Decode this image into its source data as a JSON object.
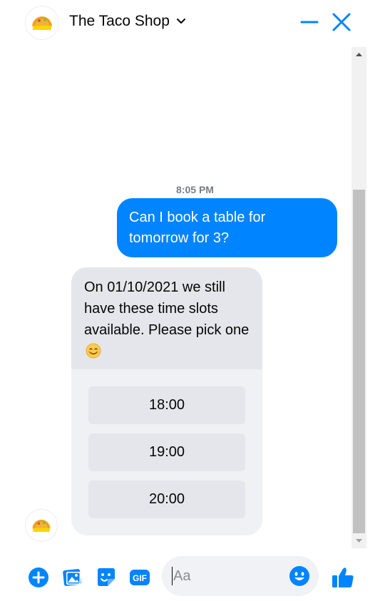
{
  "header": {
    "title": "The Taco Shop",
    "logo_text": "THE TACO SHOP"
  },
  "conversation": {
    "timestamp": "8:05 PM",
    "outgoing": {
      "text": "Can I book a table for tomorrow for 3?"
    },
    "incoming": {
      "text": "On 01/10/2021 we still have these time slots available. Please pick one",
      "emoji": "smiling-face-icon",
      "slots": [
        "18:00",
        "19:00",
        "20:00"
      ]
    }
  },
  "composer": {
    "placeholder": "Aa",
    "icons": [
      "plus-circle-icon",
      "photo-icon",
      "sticker-icon",
      "gif-icon",
      "emoji-icon",
      "thumbs-up-icon"
    ]
  },
  "colors": {
    "accent": "#0084ff",
    "incoming_bubble": "#e4e6eb",
    "card_bg": "#f0f1f5"
  }
}
